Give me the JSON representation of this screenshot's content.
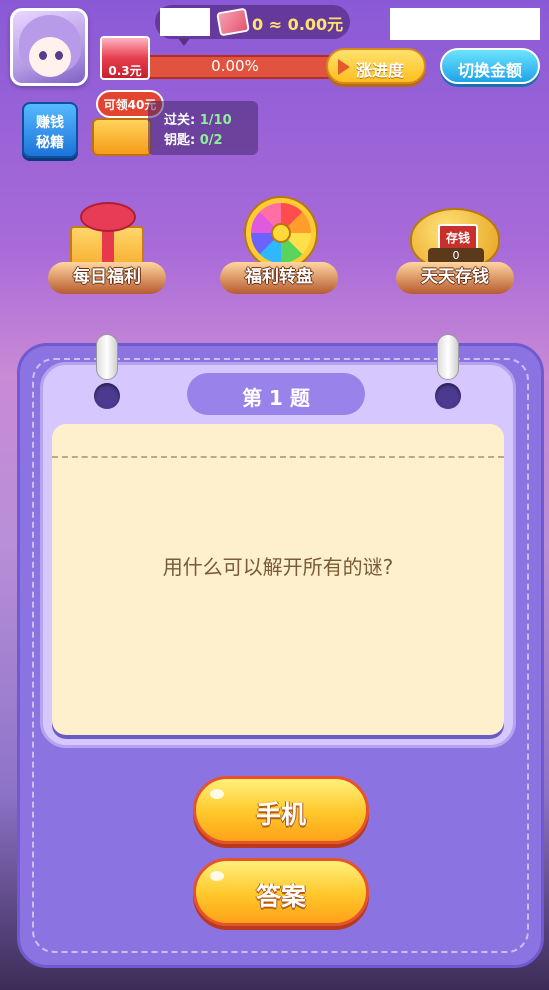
{
  "header": {
    "money_text": "0 ≈ 0.00元",
    "progress_percent": "0.00%",
    "progress_value": 0,
    "envelope_amount": "0.3元",
    "btn_progress": "涨进度",
    "btn_switch": "切换金额"
  },
  "side": {
    "book_line1": "赚钱",
    "book_line2": "秘籍",
    "chest_tag": "可领40元",
    "level_label": "过关: ",
    "level_value": "1/10",
    "key_label": "钥匙: ",
    "key_value": "0/2"
  },
  "features": [
    {
      "label": "每日福利",
      "icon": "gift-icon"
    },
    {
      "label": "福利转盘",
      "icon": "wheel-icon"
    },
    {
      "label": "天天存钱",
      "icon": "piggy-bank-icon",
      "count": "0",
      "sign": "存钱"
    }
  ],
  "quiz": {
    "title": "第 1 题",
    "question": "用什么可以解开所有的谜?",
    "options": [
      "手机",
      "答案"
    ]
  }
}
